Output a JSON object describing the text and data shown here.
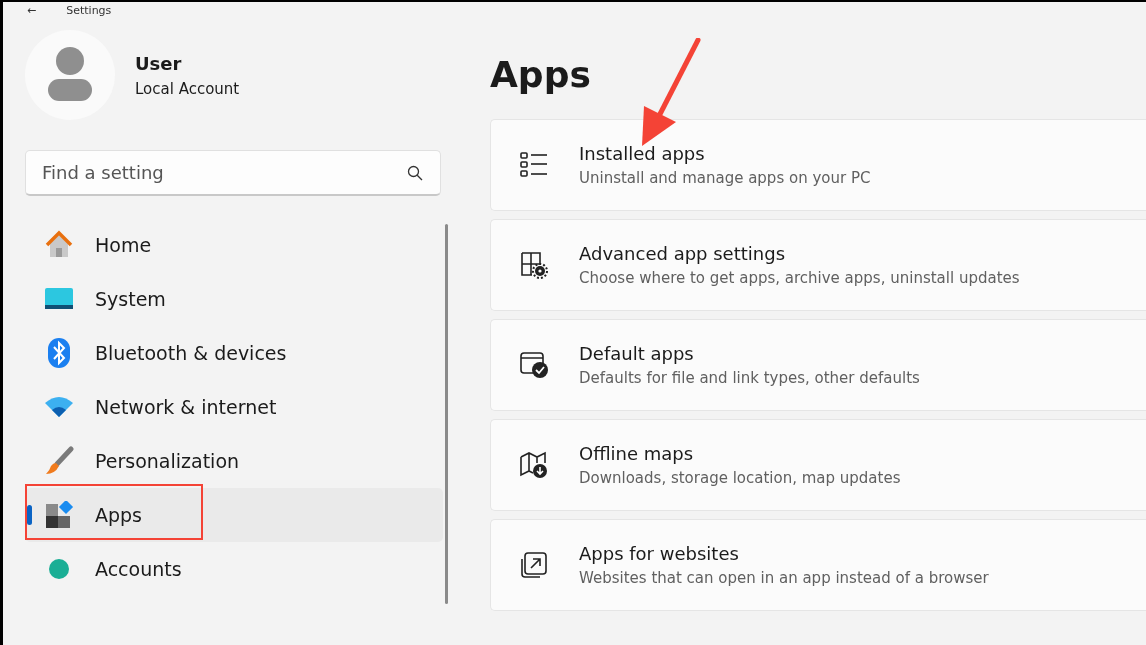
{
  "window": {
    "title": "Settings",
    "back": "←"
  },
  "profile": {
    "name": "User",
    "account": "Local Account"
  },
  "search": {
    "placeholder": "Find a setting"
  },
  "nav": [
    {
      "label": "Home",
      "kind": "home",
      "selected": false,
      "highlighted": false
    },
    {
      "label": "System",
      "kind": "system",
      "selected": false,
      "highlighted": false
    },
    {
      "label": "Bluetooth & devices",
      "kind": "bluetooth",
      "selected": false,
      "highlighted": false
    },
    {
      "label": "Network & internet",
      "kind": "network",
      "selected": false,
      "highlighted": false
    },
    {
      "label": "Personalization",
      "kind": "brush",
      "selected": false,
      "highlighted": false
    },
    {
      "label": "Apps",
      "kind": "apps",
      "selected": true,
      "highlighted": true
    },
    {
      "label": "Accounts",
      "kind": "accounts",
      "selected": false,
      "highlighted": false
    }
  ],
  "page": {
    "title": "Apps",
    "cards": [
      {
        "title": "Installed apps",
        "description": "Uninstall and manage apps on your PC",
        "kind": "list",
        "arrow": true
      },
      {
        "title": "Advanced app settings",
        "description": "Choose where to get apps, archive apps, uninstall updates",
        "kind": "gear",
        "arrow": false
      },
      {
        "title": "Default apps",
        "description": "Defaults for file and link types, other defaults",
        "kind": "check",
        "arrow": false
      },
      {
        "title": "Offline maps",
        "description": "Downloads, storage location, map updates",
        "kind": "map",
        "arrow": false
      },
      {
        "title": "Apps for websites",
        "description": "Websites that can open in an app instead of a browser",
        "kind": "link",
        "arrow": false
      }
    ]
  }
}
